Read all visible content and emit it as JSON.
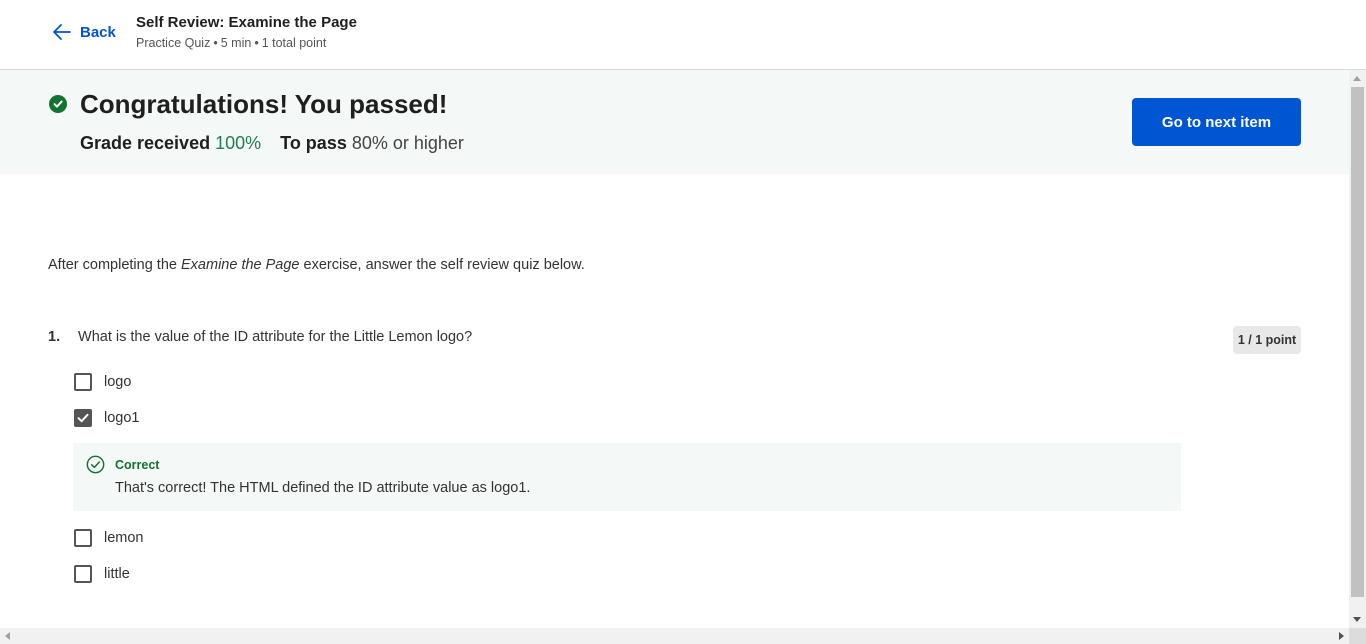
{
  "header": {
    "back_label": "Back",
    "title": "Self Review: Examine the Page",
    "meta": [
      "Practice Quiz",
      "5 min",
      "1 total point"
    ]
  },
  "banner": {
    "title": "Congratulations! You passed!",
    "grade_label": "Grade received",
    "grade_value": "100%",
    "pass_label": "To pass",
    "pass_value": "80% or higher",
    "next_button": "Go to next item"
  },
  "intro": {
    "before": "After completing the",
    "emphasis": "Examine the Page",
    "after": "exercise, answer the self review quiz below."
  },
  "question": {
    "number": "1.",
    "text": "What is the value of the ID attribute for the Little Lemon logo?",
    "points": "1 / 1 point",
    "options": [
      {
        "label": "logo",
        "checked": false
      },
      {
        "label": "logo1",
        "checked": true
      },
      {
        "label": "lemon",
        "checked": false
      },
      {
        "label": "little",
        "checked": false
      }
    ],
    "feedback": {
      "title": "Correct",
      "text": "That's correct! The HTML defined the ID attribute value as logo1."
    }
  },
  "colors": {
    "accent": "#0056d2",
    "success": "#137333",
    "grade_green": "#1e7f4f",
    "banner_bg": "#f4f8f6"
  }
}
